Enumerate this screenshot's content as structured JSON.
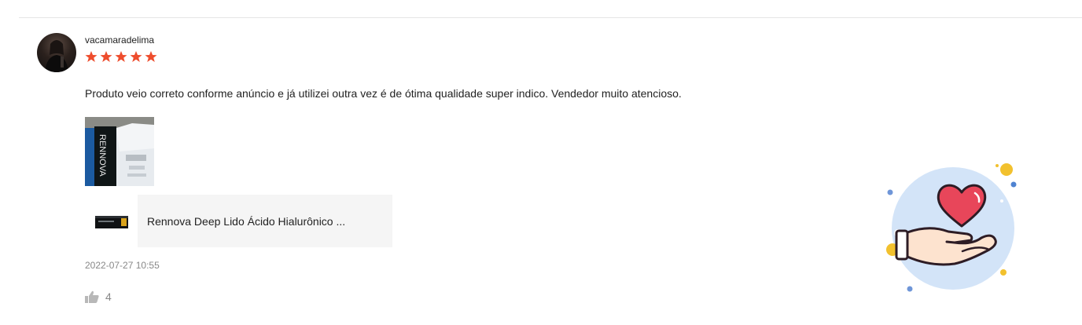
{
  "review": {
    "username": "vacamaradelima",
    "rating": 5,
    "rating_max": 5,
    "comment": "Produto veio correto conforme anúncio e já utilizei outra vez é  de ótima qualidade super indico. Vendedor muito atencioso.",
    "timestamp": "2022-07-27 10:55",
    "likes": "4"
  },
  "photo": {
    "brand_text": "RENNOVA"
  },
  "product": {
    "name": "Rennova Deep Lido Ácido Hialurônico ..."
  },
  "colors": {
    "star": "#ee4d2d",
    "divider": "#e6e6e6",
    "muted_text": "#888888",
    "product_box_bg": "#f5f5f5",
    "heart": "#e8465a"
  }
}
